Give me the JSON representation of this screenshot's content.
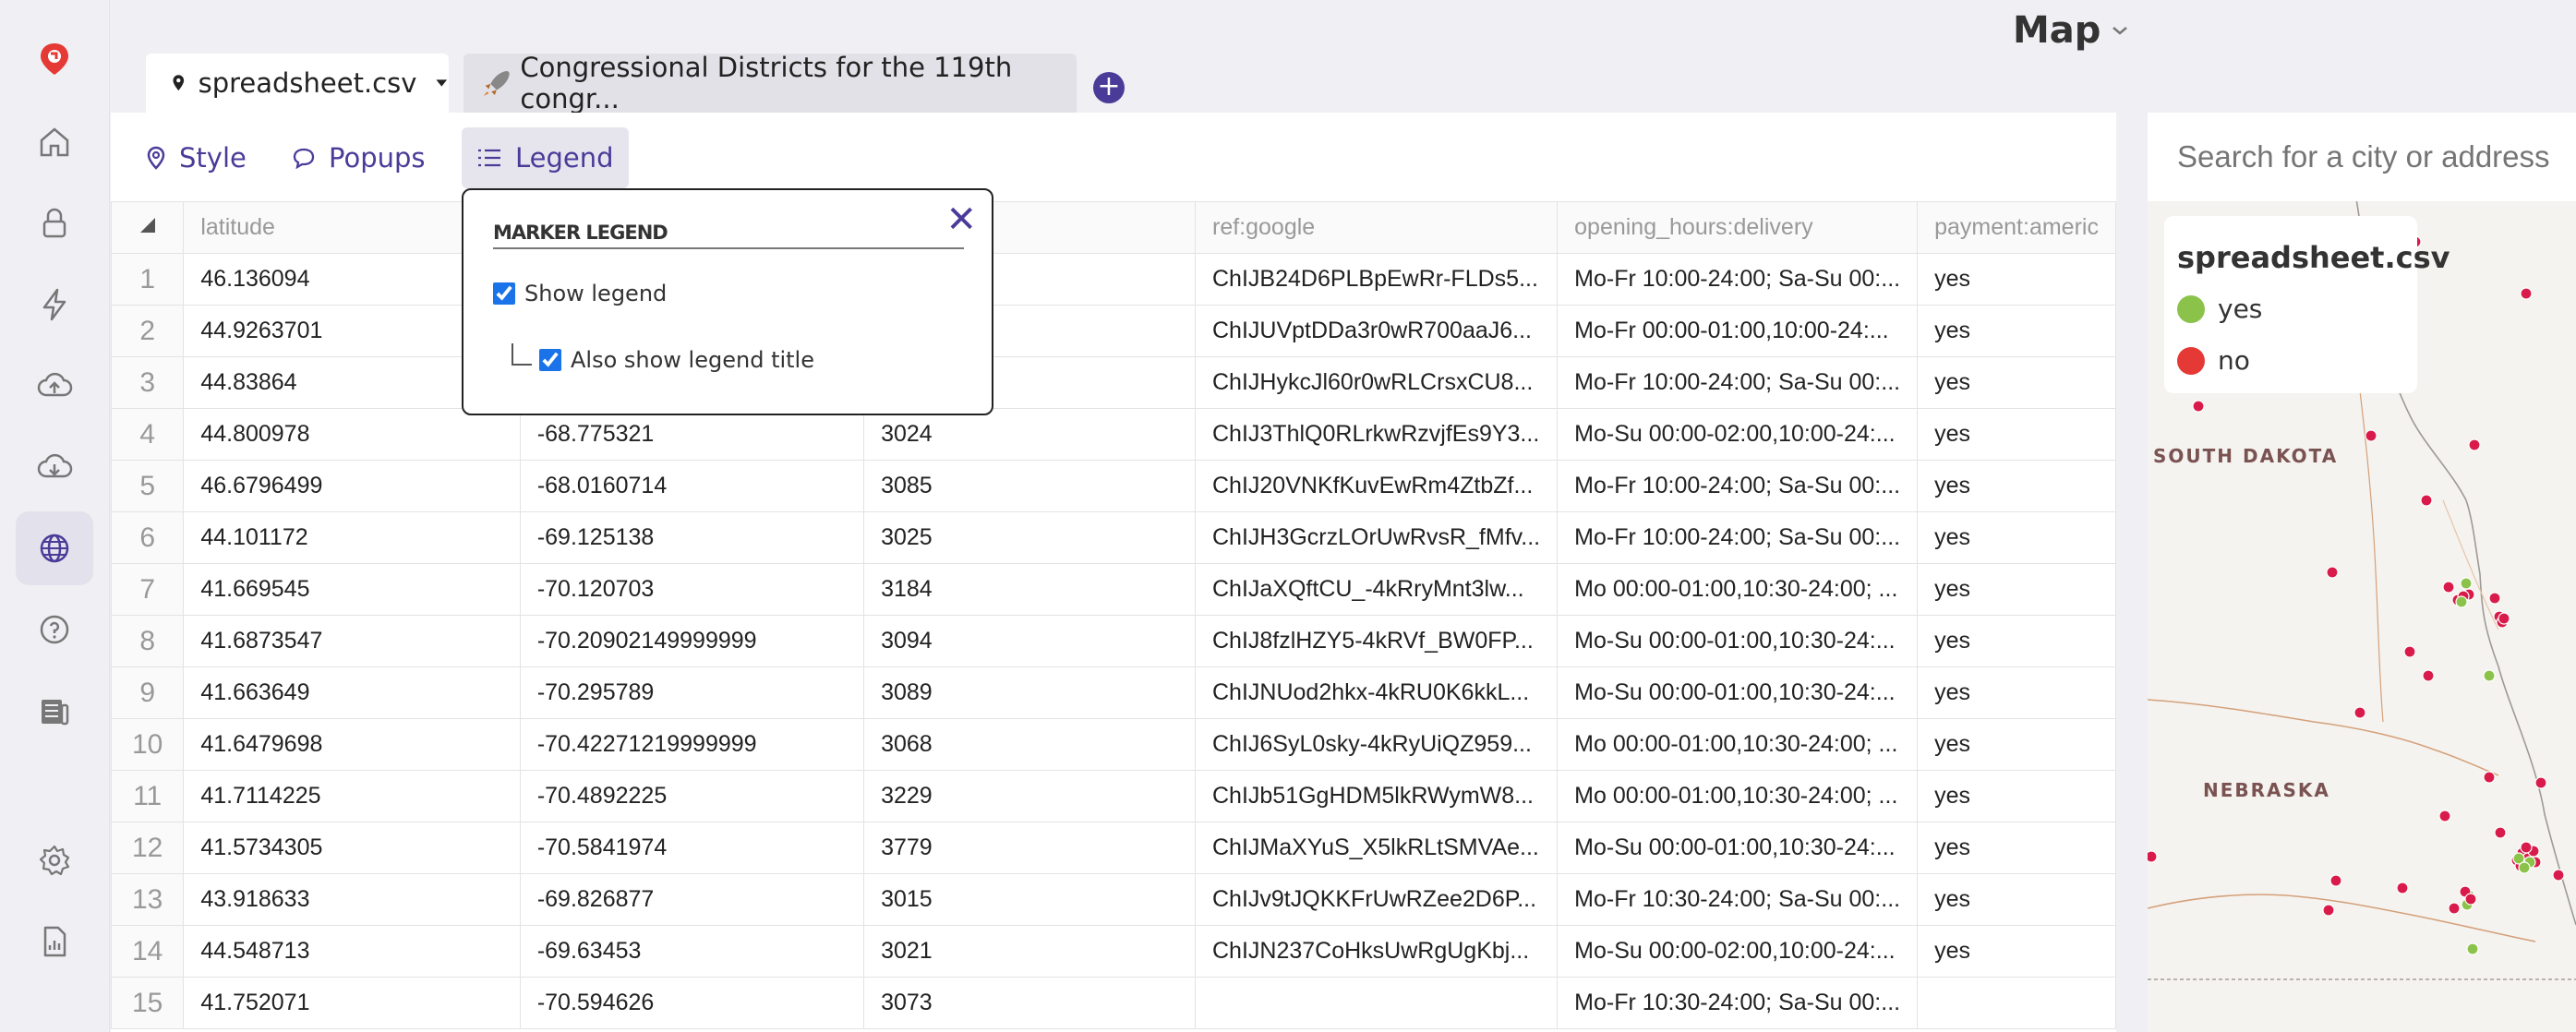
{
  "app": {
    "map_title": "Map"
  },
  "tabs": [
    {
      "label": "spreadsheet.csv"
    },
    {
      "label": "Congressional Districts for the 119th congr..."
    }
  ],
  "subtabs": [
    {
      "label": "Style"
    },
    {
      "label": "Popups"
    },
    {
      "label": "Legend"
    }
  ],
  "legend_popup": {
    "title": "MARKER LEGEND",
    "show_legend": "Show legend",
    "show_legend_title": "Also show legend title"
  },
  "table": {
    "columns": [
      "latitude",
      "",
      "",
      "ref:google",
      "opening_hours:delivery",
      "payment:americ"
    ],
    "rows": [
      {
        "n": "1",
        "lat": "46.136094",
        "lon": "",
        "c3": "",
        "ref": "ChIJB24D6PLBpEwRr-FLDs5...",
        "hours": "Mo-Fr 10:00-24:00; Sa-Su 00:...",
        "pay": "yes"
      },
      {
        "n": "2",
        "lat": "44.9263701",
        "lon": "",
        "c3": "",
        "ref": "ChIJUVptDDa3r0wR700aaJ6...",
        "hours": "Mo-Fr 00:00-01:00,10:00-24:...",
        "pay": "yes"
      },
      {
        "n": "3",
        "lat": "44.83864",
        "lon": "",
        "c3": "",
        "ref": "ChIJHykcJl60r0wRLCrsxCU8...",
        "hours": "Mo-Fr 10:00-24:00; Sa-Su 00:...",
        "pay": "yes"
      },
      {
        "n": "4",
        "lat": "44.800978",
        "lon": "-68.775321",
        "c3": "3024",
        "ref": "ChIJ3ThlQ0RLrkwRzvjfEs9Y3...",
        "hours": "Mo-Su 00:00-02:00,10:00-24:...",
        "pay": "yes"
      },
      {
        "n": "5",
        "lat": "46.6796499",
        "lon": "-68.0160714",
        "c3": "3085",
        "ref": "ChIJ20VNKfKuvEwRm4ZtbZf...",
        "hours": "Mo-Fr 10:00-24:00; Sa-Su 00:...",
        "pay": "yes"
      },
      {
        "n": "6",
        "lat": "44.101172",
        "lon": "-69.125138",
        "c3": "3025",
        "ref": "ChIJH3GcrzLOrUwRvsR_fMfv...",
        "hours": "Mo-Fr 10:00-24:00; Sa-Su 00:...",
        "pay": "yes"
      },
      {
        "n": "7",
        "lat": "41.669545",
        "lon": "-70.120703",
        "c3": "3184",
        "ref": "ChIJaXQftCU_-4kRryMnt3lw...",
        "hours": "Mo 00:00-01:00,10:30-24:00; ...",
        "pay": "yes"
      },
      {
        "n": "8",
        "lat": "41.6873547",
        "lon": "-70.20902149999999",
        "c3": "3094",
        "ref": "ChIJ8fzlHZY5-4kRVf_BW0FP...",
        "hours": "Mo-Su 00:00-01:00,10:30-24:...",
        "pay": "yes"
      },
      {
        "n": "9",
        "lat": "41.663649",
        "lon": "-70.295789",
        "c3": "3089",
        "ref": "ChIJNUod2hkx-4kRU0K6kkL...",
        "hours": "Mo-Su 00:00-01:00,10:30-24:...",
        "pay": "yes"
      },
      {
        "n": "10",
        "lat": "41.6479698",
        "lon": "-70.42271219999999",
        "c3": "3068",
        "ref": "ChIJ6SyL0sky-4kRyUiQZ959...",
        "hours": "Mo 00:00-01:00,10:30-24:00; ...",
        "pay": "yes"
      },
      {
        "n": "11",
        "lat": "41.7114225",
        "lon": "-70.4892225",
        "c3": "3229",
        "ref": "ChIJb51GgHDM5lkRWymW8...",
        "hours": "Mo 00:00-01:00,10:30-24:00; ...",
        "pay": "yes"
      },
      {
        "n": "12",
        "lat": "41.5734305",
        "lon": "-70.5841974",
        "c3": "3779",
        "ref": "ChIJMaXYuS_X5lkRLtSMVAe...",
        "hours": "Mo-Su 00:00-01:00,10:30-24:...",
        "pay": "yes"
      },
      {
        "n": "13",
        "lat": "43.918633",
        "lon": "-69.826877",
        "c3": "3015",
        "ref": "ChIJv9tJQKKFrUwRZee2D6P...",
        "hours": "Mo-Fr 10:30-24:00; Sa-Su 00:...",
        "pay": "yes"
      },
      {
        "n": "14",
        "lat": "44.548713",
        "lon": "-69.63453",
        "c3": "3021",
        "ref": "ChIJN237CoHksUwRgUgKbj...",
        "hours": "Mo-Su 00:00-02:00,10:00-24:...",
        "pay": "yes"
      },
      {
        "n": "15",
        "lat": "41.752071",
        "lon": "-70.594626",
        "c3": "3073",
        "ref": "",
        "hours": "Mo-Fr 10:30-24:00; Sa-Su 00:...",
        "pay": ""
      }
    ]
  },
  "map": {
    "search_placeholder": "Search for a city or address",
    "legend": {
      "title": "spreadsheet.csv",
      "items": [
        {
          "label": "yes",
          "color": "#8bc34a"
        },
        {
          "label": "no",
          "color": "#e53935"
        }
      ]
    },
    "states": [
      "SOUTH DAKOTA",
      "NEBRASKA"
    ]
  },
  "colors": {
    "accent": "#4b3b99",
    "brand": "#e53935",
    "marker_yes": "#8bc34a",
    "marker_no": "#d81b4a"
  }
}
